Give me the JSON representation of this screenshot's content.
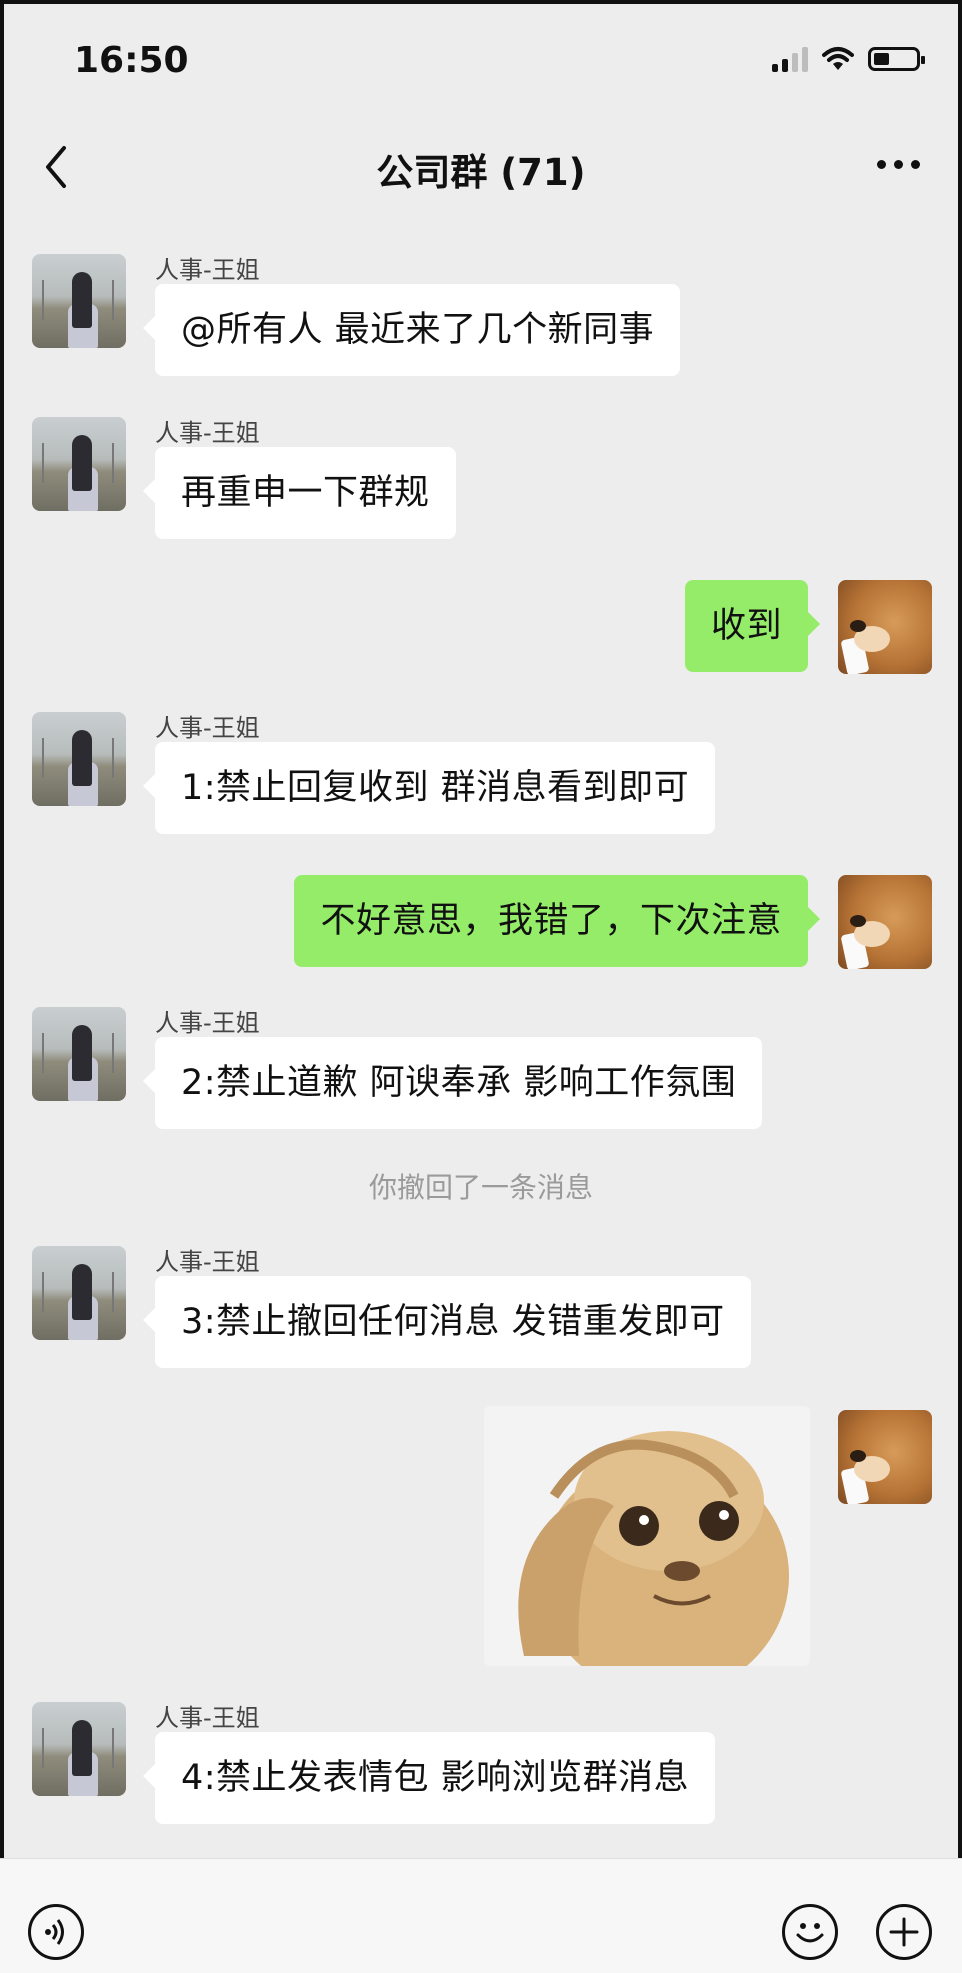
{
  "status_bar": {
    "time": "16:50"
  },
  "header": {
    "title": "公司群 (71)"
  },
  "messages": [
    {
      "sender": "人事-王姐",
      "text": "@所有人 最近来了几个新同事"
    },
    {
      "sender": "人事-王姐",
      "text": "再重申一下群规"
    },
    {
      "text": "收到"
    },
    {
      "sender": "人事-王姐",
      "text": "1:禁止回复收到  群消息看到即可"
    },
    {
      "text": "不好意思，我错了，下次注意"
    },
    {
      "sender": "人事-王姐",
      "text": "2:禁止道歉 阿谀奉承 影响工作氛围"
    },
    {
      "sender": "人事-王姐",
      "text": "3:禁止撤回任何消息 发错重发即可"
    },
    {
      "sender": "人事-王姐",
      "text": "4:禁止发表情包 影响浏览群消息"
    }
  ],
  "system_message": "你撤回了一条消息",
  "colors": {
    "background": "#ededed",
    "outgoing_bubble": "#95ec69",
    "incoming_bubble": "#ffffff"
  },
  "icons": [
    "back-chevron-icon",
    "more-icon",
    "voice-icon",
    "emoji-icon",
    "plus-icon",
    "signal-icon",
    "wifi-icon",
    "battery-icon"
  ]
}
